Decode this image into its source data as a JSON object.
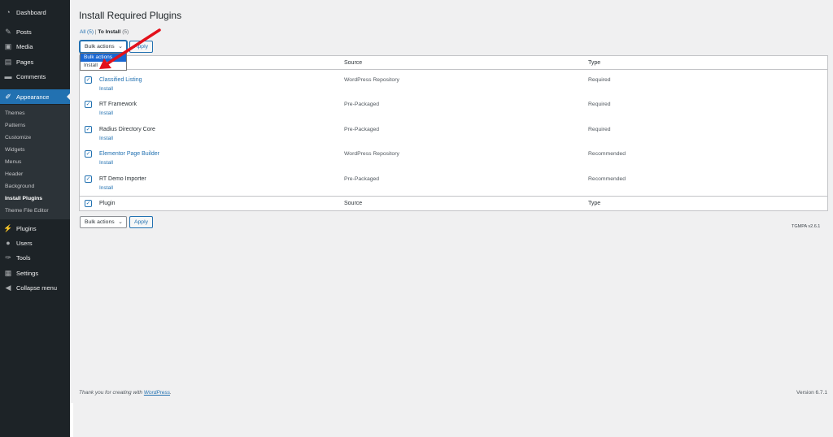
{
  "sidebar": {
    "items": [
      {
        "label": "Dashboard",
        "icon": "dashboard-icon"
      },
      {
        "label": "Posts",
        "icon": "pin-icon"
      },
      {
        "label": "Media",
        "icon": "media-icon"
      },
      {
        "label": "Pages",
        "icon": "pages-icon"
      },
      {
        "label": "Comments",
        "icon": "comments-icon"
      },
      {
        "label": "Appearance",
        "icon": "paintbrush-icon"
      },
      {
        "label": "Plugins",
        "icon": "plug-icon"
      },
      {
        "label": "Users",
        "icon": "users-icon"
      },
      {
        "label": "Tools",
        "icon": "wrench-icon"
      },
      {
        "label": "Settings",
        "icon": "settings-icon"
      },
      {
        "label": "Collapse menu",
        "icon": "collapse-icon"
      }
    ],
    "submenu": [
      "Themes",
      "Patterns",
      "Customize",
      "Widgets",
      "Menus",
      "Header",
      "Background",
      "Install Plugins",
      "Theme File Editor"
    ]
  },
  "page": {
    "title": "Install Required Plugins",
    "filters": {
      "all": "All",
      "all_count": "(5)",
      "separator": "|",
      "to_install": "To Install",
      "to_install_count": "(5)"
    }
  },
  "bulk": {
    "select_label": "Bulk actions",
    "apply_label": "Apply",
    "dropdown_options": [
      "Bulk actions",
      "Install"
    ]
  },
  "table": {
    "columns": {
      "plugin": "Plugin",
      "source": "Source",
      "type": "Type"
    },
    "install_label": "Install",
    "rows": [
      {
        "name": "Classified Listing",
        "source": "WordPress Repository",
        "type": "Required"
      },
      {
        "name": "RT Framework",
        "source": "Pre-Packaged",
        "type": "Required"
      },
      {
        "name": "Radius Directory Core",
        "source": "Pre-Packaged",
        "type": "Required"
      },
      {
        "name": "Elementor Page Builder",
        "source": "WordPress Repository",
        "type": "Recommended"
      },
      {
        "name": "RT Demo Importer",
        "source": "Pre-Packaged",
        "type": "Recommended"
      }
    ]
  },
  "tgmpa_version": "TGMPA v2.6.1",
  "footer": {
    "thanks_prefix": "Thank you for creating with",
    "wordpress_link": "WordPress",
    "thanks_suffix": ".",
    "version": "Version 6.7.1"
  },
  "colors": {
    "accent": "#2271b1",
    "sidebar_bg": "#1d2327",
    "arrow": "#e3111b"
  }
}
